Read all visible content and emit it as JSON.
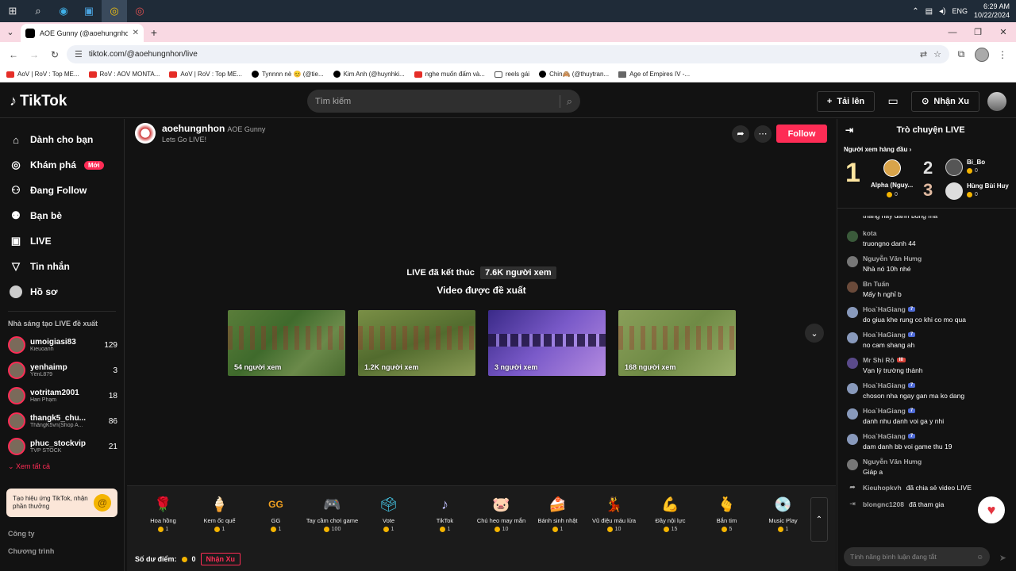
{
  "taskbar": {
    "time": "6:29 AM",
    "date": "10/22/2024",
    "lang": "ENG",
    "tray_icons": [
      "chevron-up-icon",
      "network-icon",
      "volume-icon"
    ]
  },
  "browser": {
    "tab_title": "AOE Gunny (@aoehungnhon) ·",
    "url": "tiktok.com/@aoehungnhon/live",
    "bookmarks": [
      {
        "label": "AoV | RoV : Top ME...",
        "icon": "yt"
      },
      {
        "label": "RoV : AOV MONTA...",
        "icon": "yt"
      },
      {
        "label": "AoV | RoV : Top ME...",
        "icon": "yt"
      },
      {
        "label": "Tynnnn nè 😊 (@tie...",
        "icon": "tt"
      },
      {
        "label": "Kim Anh (@huynhki...",
        "icon": "tt"
      },
      {
        "label": "nghe muốn đấm và...",
        "icon": "yt"
      },
      {
        "label": "reels gái",
        "icon": "folder"
      },
      {
        "label": "Chin🙈 (@thuytran...",
        "icon": "tt"
      },
      {
        "label": "Age of Empires IV -...",
        "icon": "aoe"
      }
    ]
  },
  "header": {
    "logo": "TikTok",
    "search_placeholder": "Tìm kiếm",
    "upload_label": "Tải lên",
    "coins_label": "Nhận Xu"
  },
  "sidebar": {
    "nav": [
      {
        "label": "Dành cho bạn",
        "icon": "home-icon",
        "glyph": "⌂"
      },
      {
        "label": "Khám phá",
        "icon": "compass-icon",
        "glyph": "◎",
        "badge": "Mới"
      },
      {
        "label": "Đang Follow",
        "icon": "person-plus-icon",
        "glyph": "⚇"
      },
      {
        "label": "Bạn bè",
        "icon": "friends-icon",
        "glyph": "⚉"
      },
      {
        "label": "LIVE",
        "icon": "live-icon",
        "glyph": "▣"
      },
      {
        "label": "Tin nhắn",
        "icon": "paper-plane-icon",
        "glyph": "▽"
      },
      {
        "label": "Hồ sơ",
        "icon": "profile-avatar",
        "glyph": "●"
      }
    ],
    "creators_heading": "Nhà sáng tạo LIVE đề xuất",
    "creators": [
      {
        "name": "umoigiasi83",
        "sub": "Kieuoanh",
        "count": "129"
      },
      {
        "name": "yenhaimp",
        "sub": "YếnL879",
        "count": "3"
      },
      {
        "name": "votritam2001",
        "sub": "Hari Phạm",
        "count": "18"
      },
      {
        "name": "thangk5_chu...",
        "sub": "ThắngK5vn(Shop A...",
        "count": "86"
      },
      {
        "name": "phuc_stockvip",
        "sub": "TVP STOCK",
        "count": "21"
      }
    ],
    "see_all": "Xem tất cả",
    "promo_text": "Tạo hiệu ứng TikTok, nhận phần thưởng",
    "footer": [
      "Công ty",
      "Chương trình"
    ]
  },
  "main": {
    "streamer_name": "aoehungnhon",
    "streamer_nick": "AOE Gunny",
    "stream_title": "Lets Go LIVE!",
    "follow_label": "Follow",
    "ended_text": "LIVE đã kết thúc",
    "viewer_count": "7.6K người xem",
    "suggested_title": "Video được đề xuất",
    "suggested": [
      {
        "viewers": "54 người xem",
        "theme": "g1"
      },
      {
        "viewers": "1.2K người xem",
        "theme": "g2"
      },
      {
        "viewers": "3 người xem",
        "theme": "g3"
      },
      {
        "viewers": "168 người xem",
        "theme": "g4"
      }
    ]
  },
  "gifts": {
    "items": [
      {
        "name": "Hoa hồng",
        "price": "1",
        "glyph": "🌹"
      },
      {
        "name": "Kem ốc quế",
        "price": "1",
        "glyph": "🍦"
      },
      {
        "name": "GG",
        "price": "1",
        "glyph": "GG"
      },
      {
        "name": "Tay cầm chơi game",
        "price": "100",
        "glyph": "🎮"
      },
      {
        "name": "Vote",
        "price": "1",
        "glyph": "🗳"
      },
      {
        "name": "TikTok",
        "price": "1",
        "glyph": "♪"
      },
      {
        "name": "Chú heo may mắn",
        "price": "10",
        "glyph": "🐷"
      },
      {
        "name": "Bánh sinh nhật",
        "price": "1",
        "glyph": "🍰"
      },
      {
        "name": "Vũ điệu máu lửa",
        "price": "10",
        "glyph": "💃"
      },
      {
        "name": "Đầy nội lực",
        "price": "15",
        "glyph": "💪"
      },
      {
        "name": "Bắn tim",
        "price": "5",
        "glyph": "🫰"
      },
      {
        "name": "Music Play",
        "price": "1",
        "glyph": "💿"
      }
    ],
    "balance_label": "Số dư điểm:",
    "balance_value": "0",
    "coins_button": "Nhận Xu"
  },
  "chat": {
    "title": "Trò chuyện LIVE",
    "top_viewers_label": "Người xem hàng đầu",
    "ranks": [
      {
        "rank": "1",
        "name": "Alpha (Nguy...",
        "coins": "0"
      },
      {
        "rank": "2",
        "name": "Bi_Bo",
        "coins": "0"
      },
      {
        "rank": "3",
        "name": "Hùng Bùi Huy",
        "coins": "0"
      }
    ],
    "messages": [
      {
        "user": "",
        "text": "thang nay danh bung ma",
        "level": ""
      },
      {
        "user": "kota",
        "text": "truongno danh 44",
        "level": ""
      },
      {
        "user": "Nguyễn Văn Hưng",
        "text": "Nhà nó 10h nhé",
        "level": ""
      },
      {
        "user": "Bn Tuấn",
        "text": "Mấy h nghỉ b",
        "level": ""
      },
      {
        "user": "Hoa`HaGiang",
        "text": "do giua khe rung co khi co mo qua",
        "level": "7"
      },
      {
        "user": "Hoa`HaGiang",
        "text": "no cam shang ah",
        "level": "7"
      },
      {
        "user": "Mr Shi Rô",
        "text": "Vạn lý trường thành",
        "level": "III"
      },
      {
        "user": "Hoa`HaGiang",
        "text": "choson nha ngay gan ma ko dang",
        "level": "7"
      },
      {
        "user": "Hoa`HaGiang",
        "text": "danh nhu danh voi ga y nhi",
        "level": "7"
      },
      {
        "user": "Hoa`HaGiang",
        "text": "dam danh bb voi game thu 19",
        "level": "7"
      },
      {
        "user": "Nguyễn Văn Hưng",
        "text": "Giáp a",
        "level": ""
      }
    ],
    "system": [
      {
        "user": "Kieuhopkvh",
        "text": "đã chia sẻ video LIVE"
      },
      {
        "user": "blongnc1208",
        "text": "đã tham gia"
      }
    ],
    "input_placeholder": "Tính năng bình luận đang tắt"
  }
}
